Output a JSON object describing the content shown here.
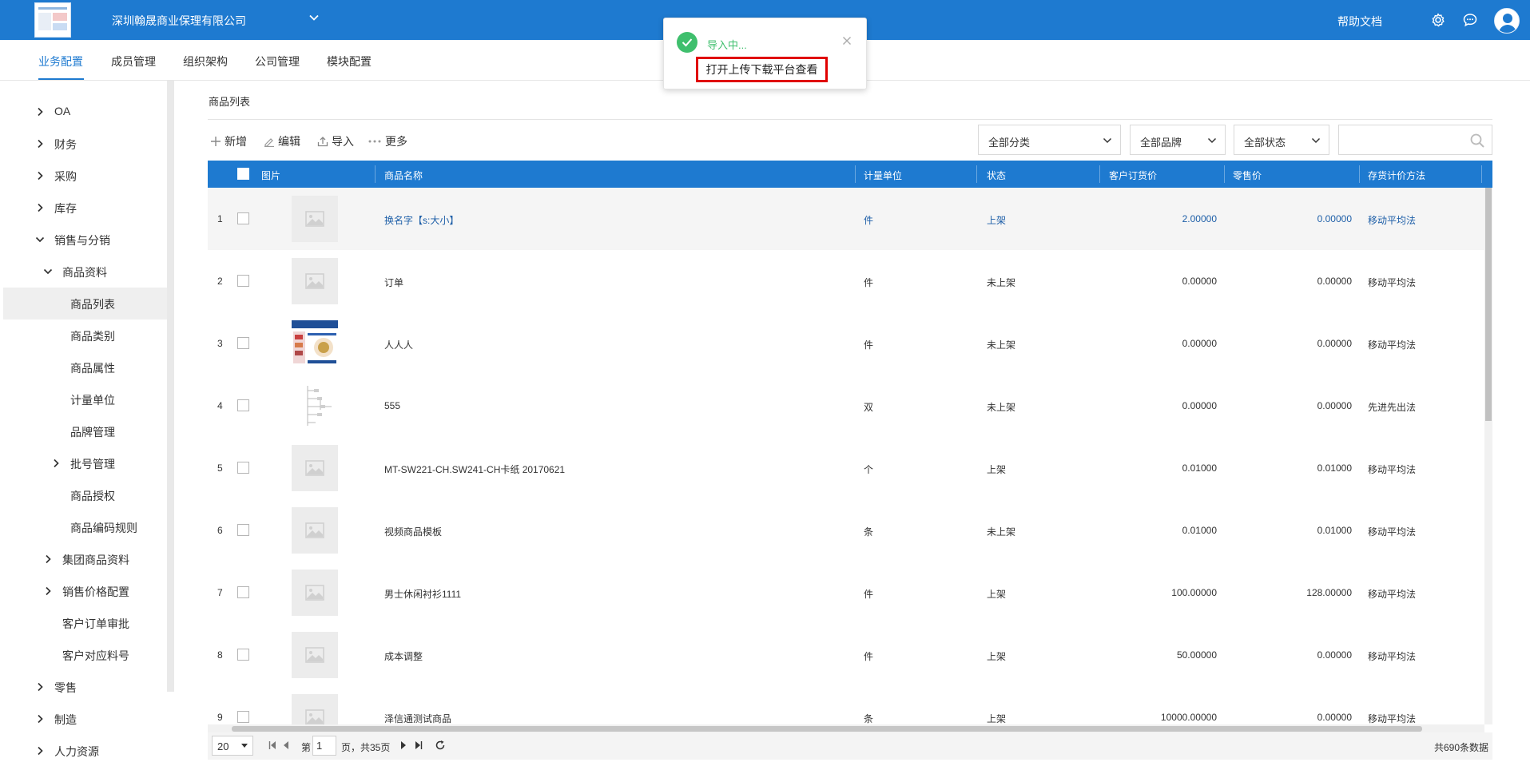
{
  "header": {
    "company": "深圳翰晟商业保理有限公司",
    "help": "帮助文档",
    "brand_color": "#1e7ad0"
  },
  "tabs": [
    {
      "label": "业务配置",
      "active": true
    },
    {
      "label": "成员管理",
      "active": false
    },
    {
      "label": "组织架构",
      "active": false
    },
    {
      "label": "公司管理",
      "active": false
    },
    {
      "label": "模块配置",
      "active": false
    }
  ],
  "sidebar": {
    "items": [
      {
        "label": "OA",
        "expander": "right",
        "level": 0
      },
      {
        "label": "财务",
        "expander": "right",
        "level": 0
      },
      {
        "label": "采购",
        "expander": "right",
        "level": 0
      },
      {
        "label": "库存",
        "expander": "right",
        "level": 0
      },
      {
        "label": "销售与分销",
        "expander": "down",
        "level": 0
      },
      {
        "label": "商品资料",
        "expander": "down",
        "level": 1
      },
      {
        "label": "商品列表",
        "expander": "none",
        "level": 2,
        "active": true
      },
      {
        "label": "商品类别",
        "expander": "none",
        "level": 2
      },
      {
        "label": "商品属性",
        "expander": "none",
        "level": 2
      },
      {
        "label": "计量单位",
        "expander": "none",
        "level": 2
      },
      {
        "label": "品牌管理",
        "expander": "none",
        "level": 2
      },
      {
        "label": "批号管理",
        "expander": "right",
        "level": 2
      },
      {
        "label": "商品授权",
        "expander": "none",
        "level": 2
      },
      {
        "label": "商品编码规则",
        "expander": "none",
        "level": 2
      },
      {
        "label": "集团商品资料",
        "expander": "right",
        "level": 1
      },
      {
        "label": "销售价格配置",
        "expander": "right",
        "level": 1
      },
      {
        "label": "客户订单审批",
        "expander": "none",
        "level": 1
      },
      {
        "label": "客户对应料号",
        "expander": "none",
        "level": 1
      },
      {
        "label": "零售",
        "expander": "right",
        "level": 0
      },
      {
        "label": "制造",
        "expander": "right",
        "level": 0
      },
      {
        "label": "人力资源",
        "expander": "right",
        "level": 0
      }
    ]
  },
  "breadcrumb": "商品列表",
  "toolbar": {
    "add": "新增",
    "edit": "编辑",
    "import": "导入",
    "more": "更多"
  },
  "filters": {
    "category": "全部分类",
    "brand": "全部品牌",
    "status": "全部状态",
    "search_placeholder": ""
  },
  "table": {
    "columns": [
      "图片",
      "商品名称",
      "计量单位",
      "状态",
      "客户订货价",
      "零售价",
      "存货计价方法"
    ],
    "rows": [
      {
        "num": "1",
        "name": "换名字【s:大小】",
        "unit": "件",
        "status": "上架",
        "order_price": "2.00000",
        "retail_price": "0.00000",
        "method": "移动平均法",
        "image": "placeholder"
      },
      {
        "num": "2",
        "name": "订单",
        "unit": "件",
        "status": "未上架",
        "order_price": "0.00000",
        "retail_price": "0.00000",
        "method": "移动平均法",
        "image": "placeholder"
      },
      {
        "num": "3",
        "name": "人人人",
        "unit": "件",
        "status": "未上架",
        "order_price": "0.00000",
        "retail_price": "0.00000",
        "method": "移动平均法",
        "image": "photo-poster"
      },
      {
        "num": "4",
        "name": "555",
        "unit": "双",
        "status": "未上架",
        "order_price": "0.00000",
        "retail_price": "0.00000",
        "method": "先进先出法",
        "image": "photo-diagram"
      },
      {
        "num": "5",
        "name": "MT-SW221-CH.SW241-CH卡纸 20170621",
        "unit": "个",
        "status": "上架",
        "order_price": "0.01000",
        "retail_price": "0.01000",
        "method": "移动平均法",
        "image": "placeholder"
      },
      {
        "num": "6",
        "name": "视频商品模板",
        "unit": "条",
        "status": "未上架",
        "order_price": "0.01000",
        "retail_price": "0.01000",
        "method": "移动平均法",
        "image": "placeholder"
      },
      {
        "num": "7",
        "name": "男士休闲衬衫1111",
        "unit": "件",
        "status": "上架",
        "order_price": "100.00000",
        "retail_price": "128.00000",
        "method": "移动平均法",
        "image": "placeholder"
      },
      {
        "num": "8",
        "name": "成本调整",
        "unit": "件",
        "status": "上架",
        "order_price": "50.00000",
        "retail_price": "0.00000",
        "method": "移动平均法",
        "image": "placeholder"
      },
      {
        "num": "9",
        "name": "泽信通测试商品",
        "unit": "条",
        "status": "上架",
        "order_price": "10000.00000",
        "retail_price": "0.00000",
        "method": "移动平均法",
        "image": "placeholder"
      }
    ]
  },
  "pager": {
    "page_size": "20",
    "page_prefix": "第",
    "page": "1",
    "page_suffix": "页，共35页",
    "total": "共690条数据"
  },
  "toast": {
    "message": "导入中...",
    "link": "打开上传下载平台查看",
    "success_color": "#3fbf6d"
  }
}
